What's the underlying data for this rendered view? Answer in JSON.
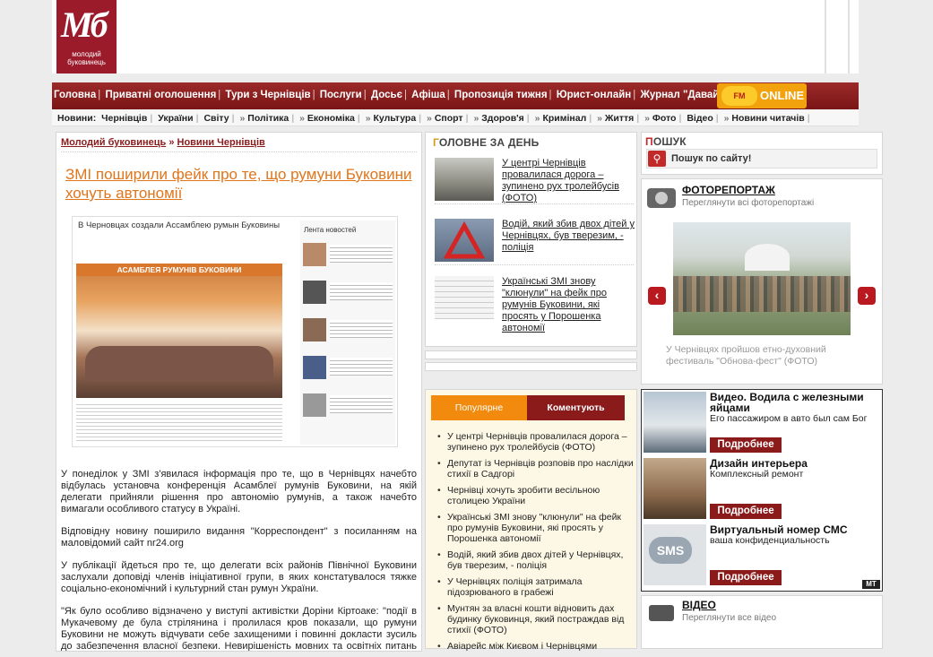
{
  "logo": {
    "mark": "Мб",
    "name_line1": "молодий",
    "name_line2": "буковинець"
  },
  "main_nav": [
    "Головна",
    "Приватні оголошення",
    "Тури з Чернівців",
    "Послуги",
    "Досьє",
    "Афіша",
    "Пропозиція тижня",
    "Юрист-онлайн",
    "Журнал \"Давай Одружимось!\""
  ],
  "online_badge": {
    "station": "FM",
    "label": "ONLINE"
  },
  "sub_nav": {
    "label": "Новини:",
    "items": [
      "Чернівців",
      "України",
      "Світу",
      "Політика",
      "Економіка",
      "Культура",
      "Спорт",
      "Здоров'я",
      "Кримінал",
      "Життя",
      "Фото",
      "Відео",
      "Новини читачів"
    ]
  },
  "breadcrumb": {
    "home": "Молодий буковинець",
    "sep": "»",
    "section": "Новини Чернівців"
  },
  "article": {
    "title": "ЗМІ поширили фейк про те, що румуни Буковини хочуть автономії",
    "image": {
      "headline": "В Черновцах создали Ассамблею румын Буковины",
      "banner": "АСАМБЛЕЯ РУМУНІВ БУКОВИНИ",
      "feed_title": "Лента новостей"
    },
    "paragraphs": [
      "У понеділок у ЗМІ з'явилася інформація про те, що в Чернівцях начебто відбулась установча конференція Асамблеї румунів Буковини, на якій делегати прийняли рішення про автономію румунів, а також начебто вимагали особливого статусу в Україні.",
      "Відповідну новину поширило видання \"Корреспондент\" з посиланням на маловідомий сайт nr24.org",
      "У публікації йдеться про те, що делегати всіх районів Північної Буковини заслухали доповіді членів ініціативної групи, в яких констатувалося тяжке соціально-економічний і культурний стан румун України.",
      "\"Як було особливо відзначено у виступі активістки Доріни Кіртоаке: \"події в Мукачевому де була стрілянина і пролилася кров показали, що румуни Буковини не можуть відчувати себе захищеними і повинні докласти зусиль до забезпечення власної безпеки. Невирішеність мовних та освітніх питань так само створює серйозну напругу в суспільстві. Як відповідь на ці"
    ]
  },
  "top_day": {
    "title_first": "Г",
    "title_rest": "ОЛОВНЕ ЗА ДЕНЬ",
    "items": [
      "У центрі Чернівців провалилася дорога – зупинено рух тролейбусів (ФОТО)",
      "Водій, який збив двох дітей у Чернівцях, був тверезим, - поліція",
      "Українські ЗМІ знову \"клюнули\" на фейк про румунів Буковини, які просять у Порошенка автономії"
    ]
  },
  "tabs": {
    "popular": "Популярне",
    "comment": "Коментують"
  },
  "popular": [
    "У центрі Чернівців провалилася дорога – зупинено рух тролейбусів (ФОТО)",
    "Депутат із Чернівців розповів про наслідки стихії в Садгорі",
    "Чернівці хочуть зробити весільною столицею України",
    "Українські ЗМІ знову \"клюнули\" на фейк про румунів Буковини, які просять у Порошенка автономії",
    "Водій, який збив двох дітей у Чернівцях, був тверезим, - поліція",
    "У Чернівцях поліція затримала підозрюваного в грабежі",
    "Мунтян за власні кошти відновить дах будинку буковинця, який постраждав від стихії (ФОТО)",
    "Авіарейс між Києвом і Чернівцями"
  ],
  "search": {
    "title_first": "П",
    "title_rest": "ОШУК",
    "label": "Пошук по сайту!",
    "icon": "search-icon"
  },
  "photo_report": {
    "title": "ФОТОРЕПОРТАЖ",
    "subtitle": "Переглянути всі фоторепортажі",
    "caption": "У Чернівцях пройшов етно-духовний фестиваль \"Обнова-фест\" (ФОТО)",
    "prev": "‹",
    "next": "›"
  },
  "ads": [
    {
      "title": "Видео. Водила с железными яйцами",
      "desc": "Его пассажиром в авто был сам Бог",
      "button": "Подробнее"
    },
    {
      "title": "Дизайн интерьера",
      "desc": "Комплексный ремонт",
      "button": "Подробнее"
    },
    {
      "title": "Виртуальный номер СМС",
      "desc": "ваша конфиденциальность",
      "button": "Подробнее",
      "image_text": "SMS"
    }
  ],
  "ads_badge": "MT",
  "video": {
    "title": "ВІДЕО",
    "subtitle": "Переглянути все відео"
  }
}
